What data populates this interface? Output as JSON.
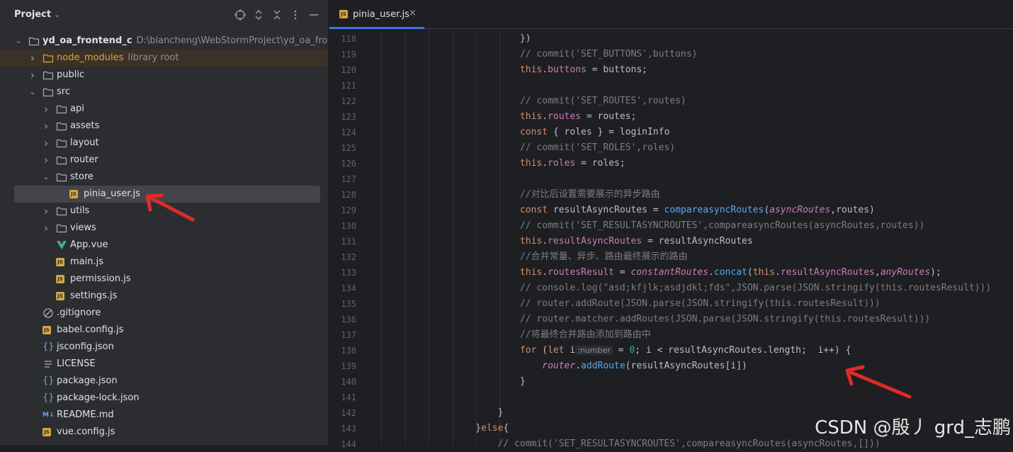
{
  "project_panel": {
    "title": "Project",
    "tree": [
      {
        "label": "yd_oa_frontend_c",
        "sub": "D:\\biancheng\\WebStormProject\\yd_oa_frontend_c",
        "icon": "folder-icon",
        "level": 0,
        "arrow": "down",
        "bold": true
      },
      {
        "label": "node_modules",
        "sub": "library root",
        "icon": "folder-icon",
        "level": 1,
        "arrow": "right",
        "lib": true
      },
      {
        "label": "public",
        "icon": "folder-icon",
        "level": 1,
        "arrow": "right"
      },
      {
        "label": "src",
        "icon": "folder-icon",
        "level": 1,
        "arrow": "down"
      },
      {
        "label": "api",
        "icon": "folder-icon",
        "level": 2,
        "arrow": "right"
      },
      {
        "label": "assets",
        "icon": "folder-icon",
        "level": 2,
        "arrow": "right"
      },
      {
        "label": "layout",
        "icon": "folder-icon",
        "level": 2,
        "arrow": "right"
      },
      {
        "label": "router",
        "icon": "folder-icon",
        "level": 2,
        "arrow": "right"
      },
      {
        "label": "store",
        "icon": "folder-icon",
        "level": 2,
        "arrow": "down"
      },
      {
        "label": "pinia_user.js",
        "icon": "js-file-icon",
        "level": 3,
        "arrow": "",
        "selected": true
      },
      {
        "label": "utils",
        "icon": "folder-icon",
        "level": 2,
        "arrow": "right"
      },
      {
        "label": "views",
        "icon": "folder-icon",
        "level": 2,
        "arrow": "right"
      },
      {
        "label": "App.vue",
        "icon": "vue-file-icon",
        "level": 2,
        "arrow": ""
      },
      {
        "label": "main.js",
        "icon": "js-file-icon",
        "level": 2,
        "arrow": ""
      },
      {
        "label": "permission.js",
        "icon": "js-file-icon",
        "level": 2,
        "arrow": ""
      },
      {
        "label": "settings.js",
        "icon": "js-file-icon",
        "level": 2,
        "arrow": ""
      },
      {
        "label": ".gitignore",
        "icon": "gitignore-file-icon",
        "level": 1,
        "arrow": ""
      },
      {
        "label": "babel.config.js",
        "icon": "js-file-icon",
        "level": 1,
        "arrow": ""
      },
      {
        "label": "jsconfig.json",
        "icon": "json-file-icon",
        "level": 1,
        "arrow": ""
      },
      {
        "label": "LICENSE",
        "icon": "text-file-icon",
        "level": 1,
        "arrow": ""
      },
      {
        "label": "package.json",
        "icon": "json-file-icon",
        "level": 1,
        "arrow": ""
      },
      {
        "label": "package-lock.json",
        "icon": "json-file-icon",
        "level": 1,
        "arrow": ""
      },
      {
        "label": "README.md",
        "icon": "markdown-file-icon",
        "level": 1,
        "arrow": ""
      },
      {
        "label": "vue.config.js",
        "icon": "js-file-icon",
        "level": 1,
        "arrow": ""
      }
    ]
  },
  "editor": {
    "tab": {
      "label": "pinia_user.js",
      "icon": "js-file-icon",
      "close": "×"
    },
    "lines": [
      {
        "n": "118",
        "indent": 18,
        "tokens": [
          [
            "plain",
            "})"
          ]
        ]
      },
      {
        "n": "119",
        "indent": 18,
        "tokens": [
          [
            "comment",
            "// commit('SET_BUTTONS',buttons)"
          ]
        ]
      },
      {
        "n": "120",
        "indent": 18,
        "tokens": [
          [
            "kw",
            "this"
          ],
          [
            "plain",
            "."
          ],
          [
            "prop",
            "buttons"
          ],
          [
            "plain",
            " = buttons;"
          ]
        ]
      },
      {
        "n": "121",
        "indent": 0,
        "tokens": []
      },
      {
        "n": "122",
        "indent": 18,
        "tokens": [
          [
            "comment",
            "// commit('SET_ROUTES',routes)"
          ]
        ]
      },
      {
        "n": "123",
        "indent": 18,
        "tokens": [
          [
            "kw",
            "this"
          ],
          [
            "plain",
            "."
          ],
          [
            "prop",
            "routes"
          ],
          [
            "plain",
            " = routes;"
          ]
        ]
      },
      {
        "n": "124",
        "indent": 18,
        "tokens": [
          [
            "kw",
            "const"
          ],
          [
            "plain",
            " { roles } = loginInfo"
          ]
        ]
      },
      {
        "n": "125",
        "indent": 18,
        "tokens": [
          [
            "comment",
            "// commit('SET_ROLES',roles)"
          ]
        ]
      },
      {
        "n": "126",
        "indent": 18,
        "tokens": [
          [
            "kw",
            "this"
          ],
          [
            "plain",
            "."
          ],
          [
            "prop",
            "roles"
          ],
          [
            "plain",
            " = roles;"
          ]
        ]
      },
      {
        "n": "127",
        "indent": 0,
        "tokens": []
      },
      {
        "n": "128",
        "indent": 18,
        "tokens": [
          [
            "comment",
            "//对比后设置需要展示的异步路由"
          ]
        ]
      },
      {
        "n": "129",
        "indent": 18,
        "tokens": [
          [
            "kw",
            "const"
          ],
          [
            "plain",
            " resultAsyncRoutes = "
          ],
          [
            "fn",
            "compareasyncRoutes"
          ],
          [
            "plain",
            "("
          ],
          [
            "param",
            "asyncRoutes"
          ],
          [
            "plain",
            ",routes)"
          ]
        ]
      },
      {
        "n": "130",
        "indent": 18,
        "tokens": [
          [
            "comment",
            "// commit('SET_RESULTASYNCROUTES',compareasyncRoutes(asyncRoutes,routes))"
          ]
        ]
      },
      {
        "n": "131",
        "indent": 18,
        "tokens": [
          [
            "kw",
            "this"
          ],
          [
            "plain",
            "."
          ],
          [
            "prop",
            "resultAsyncRoutes"
          ],
          [
            "plain",
            " = resultAsyncRoutes"
          ]
        ]
      },
      {
        "n": "132",
        "indent": 18,
        "tokens": [
          [
            "comment",
            "//合并常量、异步、路由最终展示的路由"
          ]
        ]
      },
      {
        "n": "133",
        "indent": 18,
        "tokens": [
          [
            "kw",
            "this"
          ],
          [
            "plain",
            "."
          ],
          [
            "prop",
            "routesResult"
          ],
          [
            "plain",
            " = "
          ],
          [
            "param",
            "constantRoutes"
          ],
          [
            "plain",
            "."
          ],
          [
            "fn",
            "concat"
          ],
          [
            "plain",
            "("
          ],
          [
            "kw",
            "this"
          ],
          [
            "plain",
            "."
          ],
          [
            "prop",
            "resultAsyncRoutes"
          ],
          [
            "plain",
            ","
          ],
          [
            "param",
            "anyRoutes"
          ],
          [
            "plain",
            ");"
          ]
        ]
      },
      {
        "n": "134",
        "indent": 18,
        "tokens": [
          [
            "comment",
            "// console.log(\"asd;kfjlk;asdjdkl;fds\",JSON.parse(JSON.stringify(this.routesResult)))"
          ]
        ]
      },
      {
        "n": "135",
        "indent": 18,
        "tokens": [
          [
            "comment",
            "// router.addRoute(JSON.parse(JSON.stringify(this.routesResult)))"
          ]
        ]
      },
      {
        "n": "136",
        "indent": 18,
        "tokens": [
          [
            "comment",
            "// router.matcher.addRoutes(JSON.parse(JSON.stringify(this.routesResult)))"
          ]
        ]
      },
      {
        "n": "137",
        "indent": 18,
        "tokens": [
          [
            "comment",
            "//将最终合并路由添加到路由中"
          ]
        ]
      },
      {
        "n": "138",
        "indent": 18,
        "tokens": [
          [
            "kw",
            "for"
          ],
          [
            "plain",
            " ("
          ],
          [
            "kw",
            "let"
          ],
          [
            "plain",
            " i"
          ],
          [
            "hint",
            ":number"
          ],
          [
            "plain",
            " = "
          ],
          [
            "num",
            "0"
          ],
          [
            "plain",
            "; i < resultAsyncRoutes.length;  i++) {"
          ]
        ]
      },
      {
        "n": "139",
        "indent": 22,
        "tokens": [
          [
            "param",
            "router"
          ],
          [
            "plain",
            "."
          ],
          [
            "fn",
            "addRoute"
          ],
          [
            "plain",
            "(resultAsyncRoutes[i])"
          ]
        ]
      },
      {
        "n": "140",
        "indent": 18,
        "tokens": [
          [
            "plain",
            "}"
          ]
        ]
      },
      {
        "n": "141",
        "indent": 0,
        "tokens": []
      },
      {
        "n": "142",
        "indent": 14,
        "tokens": [
          [
            "plain",
            "}"
          ]
        ]
      },
      {
        "n": "143",
        "indent": 10,
        "tokens": [
          [
            "plain",
            "}"
          ],
          [
            "kw",
            "else"
          ],
          [
            "plain",
            "{"
          ]
        ]
      },
      {
        "n": "144",
        "indent": 14,
        "tokens": [
          [
            "comment",
            "// commit('SET_RESULTASYNCROUTES',compareasyncRoutes(asyncRoutes,[]))"
          ]
        ]
      }
    ]
  },
  "watermark": "CSDN @殷丿 grd_志鹏",
  "colors": {
    "accent": "#3574f0",
    "annotation": "#e02a2a",
    "js_badge": "#d9a343",
    "vue_green": "#41b883"
  }
}
